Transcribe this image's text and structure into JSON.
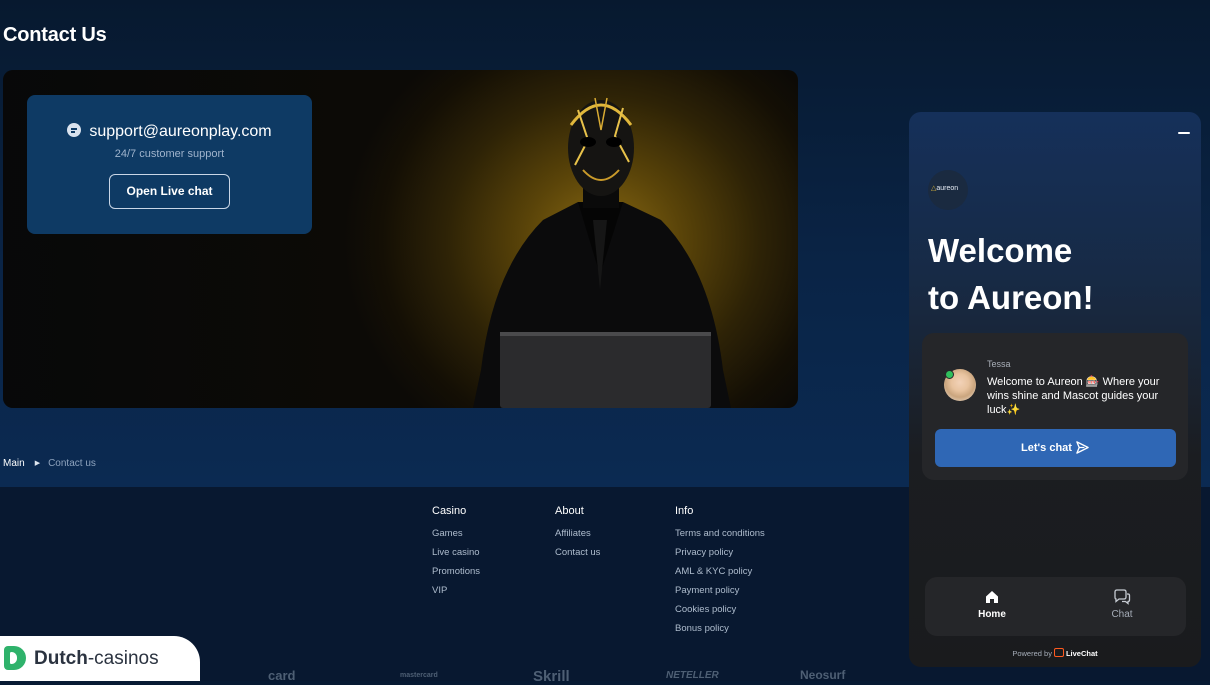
{
  "page": {
    "title": "Contact Us"
  },
  "contact": {
    "email": "support@aureonplay.com",
    "subtitle": "24/7 customer support",
    "button": "Open Live chat"
  },
  "breadcrumb": {
    "home": "Main",
    "current": "Contact us"
  },
  "footer": {
    "columns": [
      {
        "heading": "Casino",
        "links": [
          "Games",
          "Live casino",
          "Promotions",
          "VIP"
        ]
      },
      {
        "heading": "About",
        "links": [
          "Affiliates",
          "Contact us"
        ]
      },
      {
        "heading": "Info",
        "links": [
          "Terms and conditions",
          "Privacy policy",
          "AML & KYC policy",
          "Payment policy",
          "Cookies policy",
          "Bonus policy"
        ]
      }
    ],
    "payment_logos": [
      "card",
      "mastercard",
      "Skrill",
      "NETELLER",
      "Neosurf"
    ]
  },
  "badge": {
    "brand_a": "Dutch",
    "brand_b": "-casinos"
  },
  "chat": {
    "logo": "aureon",
    "welcome_line1": "Welcome",
    "welcome_line2": "to Aureon!",
    "agent_name": "Tessa",
    "message": "Welcome to Aureon 🎰 Where your wins shine and Mascot guides your luck✨",
    "cta": "Let's chat",
    "nav": [
      {
        "label": "Home",
        "icon": "home-icon"
      },
      {
        "label": "Chat",
        "icon": "chat-bubbles-icon"
      }
    ],
    "powered_prefix": "Powered by",
    "powered_brand": "LiveChat"
  },
  "colors": {
    "accent": "#2f67b5",
    "card": "#0e3a64",
    "gold": "#d7b33a"
  }
}
